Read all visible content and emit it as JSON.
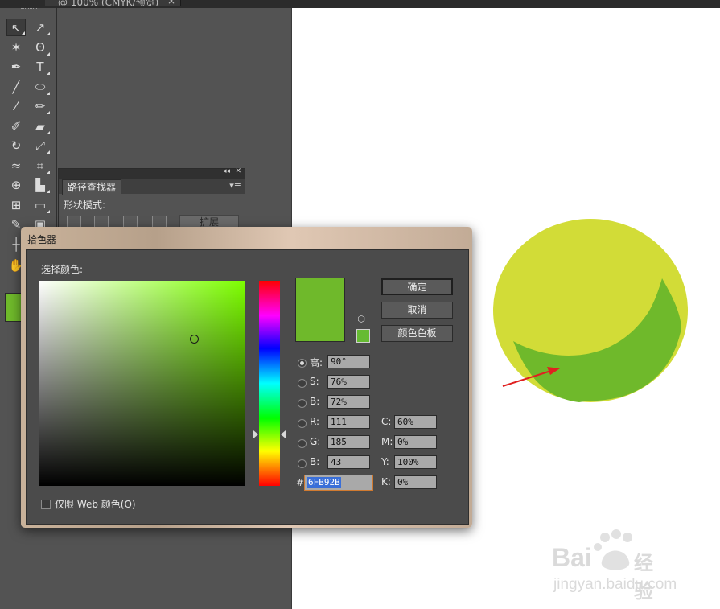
{
  "document_tab": {
    "title": "@ 100% (CMYK/预览)",
    "close": "×"
  },
  "toolbox": {
    "tools": [
      {
        "name": "selection-tool-icon",
        "glyph": "↖"
      },
      {
        "name": "direct-selection-tool-icon",
        "glyph": "↗"
      },
      {
        "name": "magic-wand-tool-icon",
        "glyph": "✶"
      },
      {
        "name": "lasso-tool-icon",
        "glyph": "ʘ"
      },
      {
        "name": "pen-tool-icon",
        "glyph": "✒"
      },
      {
        "name": "type-tool-icon",
        "glyph": "T"
      },
      {
        "name": "line-tool-icon",
        "glyph": "╱"
      },
      {
        "name": "ellipse-tool-icon",
        "glyph": "⬭"
      },
      {
        "name": "paintbrush-tool-icon",
        "glyph": "⁄"
      },
      {
        "name": "pencil-tool-icon",
        "glyph": "✏"
      },
      {
        "name": "blob-brush-tool-icon",
        "glyph": "✐"
      },
      {
        "name": "eraser-tool-icon",
        "glyph": "▰"
      },
      {
        "name": "rotate-tool-icon",
        "glyph": "↻"
      },
      {
        "name": "scale-tool-icon",
        "glyph": "⤢"
      },
      {
        "name": "width-tool-icon",
        "glyph": "≈"
      },
      {
        "name": "free-transform-tool-icon",
        "glyph": "⌗"
      },
      {
        "name": "shape-builder-tool-icon",
        "glyph": "⊕"
      },
      {
        "name": "graph-tool-icon",
        "glyph": "▙"
      },
      {
        "name": "mesh-tool-icon",
        "glyph": "⊞"
      },
      {
        "name": "gradient-tool-icon",
        "glyph": "▭"
      },
      {
        "name": "eyedropper-tool-icon",
        "glyph": "✎"
      },
      {
        "name": "blend-tool-icon",
        "glyph": "▣"
      },
      {
        "name": "artboard-tool-icon",
        "glyph": "┼"
      },
      {
        "name": "slice-tool-icon",
        "glyph": "◫"
      },
      {
        "name": "hand-tool-icon",
        "glyph": "✋"
      }
    ],
    "fill_color": "#6fb92b"
  },
  "pathfinder": {
    "tab_label": "路径查找器",
    "shape_modes_label": "形状模式:",
    "expand_label": "扩展",
    "collapse_glyph": "◂◂",
    "close_glyph": "✕",
    "menu_glyph": "▾≡"
  },
  "color_picker": {
    "title": "拾色器",
    "select_color_label": "选择颜色:",
    "ok_label": "确定",
    "cancel_label": "取消",
    "swatches_label": "颜色色板",
    "web_only_label": "仅限 Web 颜色(O)",
    "selected_color": "#6fb92b",
    "websafe_color": "#66bb33",
    "hsb": [
      {
        "label": "高:",
        "value": "90°",
        "selected": true
      },
      {
        "label": "S:",
        "value": "76%"
      },
      {
        "label": "B:",
        "value": "72%"
      }
    ],
    "rgb": [
      {
        "label": "R:",
        "value": "111"
      },
      {
        "label": "G:",
        "value": "185"
      },
      {
        "label": "B:",
        "value": "43"
      }
    ],
    "cmyk": [
      {
        "label": "C:",
        "value": "60%"
      },
      {
        "label": "M:",
        "value": "0%"
      },
      {
        "label": "Y:",
        "value": "100%"
      },
      {
        "label": "K:",
        "value": "0%"
      }
    ],
    "hash_label": "#",
    "hex_value": "6FB92B"
  },
  "artwork": {
    "circle_color": "#d2dc37",
    "crescent_color": "#6fb92b",
    "arrow_color": "#e02020"
  },
  "watermark": {
    "brand": "Bai",
    "brand2": "经验",
    "url": "jingyan.baidu.com"
  }
}
